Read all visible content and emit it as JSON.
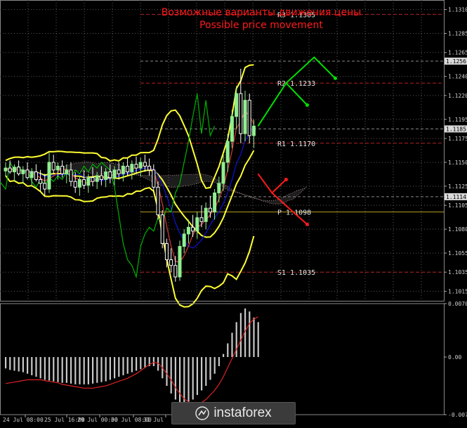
{
  "chart_data": {
    "type": "candlestick",
    "title": "Возможные варианты движения цены",
    "subtitle": "Possible price movement",
    "y_ticks": [
      "1.1310",
      "1.1285",
      "1.1265",
      "1.1240",
      "1.1220",
      "1.1195",
      "1.1175",
      "1.1150",
      "1.1125",
      "1.1105",
      "1.1080",
      "1.1055",
      "1.1035",
      "1.1015"
    ],
    "y_range": [
      1.1005,
      1.132
    ],
    "price_labels": [
      {
        "text": "1.1256",
        "value": 1.1256
      },
      {
        "text": "1.1185",
        "value": 1.1185
      },
      {
        "text": "1.1114",
        "value": 1.1114
      }
    ],
    "x_ticks": [
      "24 Jul 08:00",
      "25 Jul 16:00",
      "29 Jul 00:00",
      "30 Jul 08:00",
      "31 Jul"
    ],
    "levels": [
      {
        "name": "R3",
        "text": "R3 1.1305",
        "value": 1.1305
      },
      {
        "name": "R2",
        "text": "R2 1.1233",
        "value": 1.1233
      },
      {
        "name": "R1",
        "text": "R1 1.1170",
        "value": 1.117
      },
      {
        "name": "P",
        "text": "P 1.1098",
        "value": 1.1098
      },
      {
        "name": "S1",
        "text": "S1 1.1035",
        "value": 1.1035
      }
    ],
    "candles": [
      [
        1.1141,
        1.115,
        1.1135,
        1.1144
      ],
      [
        1.1144,
        1.1152,
        1.1138,
        1.114
      ],
      [
        1.114,
        1.1148,
        1.113,
        1.1145
      ],
      [
        1.1145,
        1.1152,
        1.1136,
        1.1138
      ],
      [
        1.1138,
        1.1146,
        1.1128,
        1.1142
      ],
      [
        1.1142,
        1.115,
        1.1132,
        1.1134
      ],
      [
        1.1134,
        1.1144,
        1.1125,
        1.114
      ],
      [
        1.114,
        1.1148,
        1.113,
        1.1132
      ],
      [
        1.1132,
        1.1142,
        1.112,
        1.1128
      ],
      [
        1.1128,
        1.1138,
        1.1115,
        1.1122
      ],
      [
        1.1122,
        1.116,
        1.1118,
        1.115
      ],
      [
        1.115,
        1.1158,
        1.1138,
        1.1142
      ],
      [
        1.1142,
        1.115,
        1.1132,
        1.1146
      ],
      [
        1.1146,
        1.1152,
        1.1134,
        1.1138
      ],
      [
        1.1138,
        1.1148,
        1.1128,
        1.1142
      ],
      [
        1.1142,
        1.115,
        1.1125,
        1.113
      ],
      [
        1.113,
        1.114,
        1.1118,
        1.1124
      ],
      [
        1.1124,
        1.1136,
        1.1115,
        1.1132
      ],
      [
        1.1132,
        1.1142,
        1.1122,
        1.1126
      ],
      [
        1.1126,
        1.1138,
        1.1118,
        1.1134
      ],
      [
        1.1134,
        1.1145,
        1.1125,
        1.113
      ],
      [
        1.113,
        1.114,
        1.1122,
        1.1136
      ],
      [
        1.1136,
        1.1146,
        1.1126,
        1.1132
      ],
      [
        1.1132,
        1.1144,
        1.1124,
        1.114
      ],
      [
        1.114,
        1.1148,
        1.1128,
        1.1134
      ],
      [
        1.1134,
        1.1146,
        1.1126,
        1.1142
      ],
      [
        1.1142,
        1.115,
        1.1132,
        1.1138
      ],
      [
        1.1138,
        1.115,
        1.113,
        1.1146
      ],
      [
        1.1146,
        1.1154,
        1.1136,
        1.114
      ],
      [
        1.114,
        1.1152,
        1.1132,
        1.1148
      ],
      [
        1.1148,
        1.1156,
        1.1138,
        1.1144
      ],
      [
        1.1144,
        1.1155,
        1.1135,
        1.115
      ],
      [
        1.115,
        1.1158,
        1.114,
        1.1146
      ],
      [
        1.1146,
        1.1154,
        1.1136,
        1.1142
      ],
      [
        1.1142,
        1.1148,
        1.112,
        1.1124
      ],
      [
        1.1124,
        1.113,
        1.109,
        1.1095
      ],
      [
        1.1095,
        1.11,
        1.106,
        1.1065
      ],
      [
        1.1065,
        1.107,
        1.104,
        1.1048
      ],
      [
        1.1048,
        1.106,
        1.1035,
        1.1042
      ],
      [
        1.1042,
        1.1052,
        1.1025,
        1.103
      ],
      [
        1.103,
        1.1068,
        1.1026,
        1.1062
      ],
      [
        1.1062,
        1.108,
        1.1055,
        1.1075
      ],
      [
        1.1075,
        1.109,
        1.1065,
        1.1082
      ],
      [
        1.1082,
        1.1095,
        1.1072,
        1.1078
      ],
      [
        1.1078,
        1.1098,
        1.107,
        1.1092
      ],
      [
        1.1092,
        1.1105,
        1.1082,
        1.1088
      ],
      [
        1.1088,
        1.1108,
        1.108,
        1.1102
      ],
      [
        1.1102,
        1.1115,
        1.1092,
        1.1098
      ],
      [
        1.1098,
        1.1122,
        1.109,
        1.1118
      ],
      [
        1.1118,
        1.1135,
        1.1108,
        1.1128
      ],
      [
        1.1128,
        1.1158,
        1.112,
        1.115
      ],
      [
        1.115,
        1.118,
        1.114,
        1.1172
      ],
      [
        1.1172,
        1.1205,
        1.1165,
        1.1198
      ],
      [
        1.1198,
        1.123,
        1.1185,
        1.1222
      ],
      [
        1.1222,
        1.1248,
        1.117,
        1.118
      ],
      [
        1.118,
        1.1225,
        1.1172,
        1.1215
      ],
      [
        1.1215,
        1.1222,
        1.117,
        1.1178
      ],
      [
        1.1178,
        1.1195,
        1.1165,
        1.1188
      ]
    ],
    "forecast_paths": [
      {
        "color": "#00e000",
        "points": [
          [
            0,
            1.1188
          ],
          [
            4,
            1.1233
          ],
          [
            7,
            1.121
          ]
        ]
      },
      {
        "color": "#00e000",
        "points": [
          [
            4,
            1.1233
          ],
          [
            8,
            1.126
          ],
          [
            11,
            1.1238
          ]
        ]
      },
      {
        "color": "#ff1a1a",
        "points": [
          [
            0,
            1.1138
          ],
          [
            2,
            1.1118
          ],
          [
            4,
            1.1132
          ]
        ]
      },
      {
        "color": "#ff1a1a",
        "points": [
          [
            2,
            1.1118
          ],
          [
            5,
            1.1098
          ],
          [
            7,
            1.1085
          ]
        ]
      }
    ],
    "macd_ticks": [
      "0.00704",
      "0.00",
      "-0.00759"
    ],
    "macd_range": [
      -0.00759,
      0.00704
    ],
    "macd_histogram": [
      -0.0015,
      -0.0017,
      -0.0018,
      -0.0019,
      -0.002,
      -0.0022,
      -0.0024,
      -0.0026,
      -0.0028,
      -0.003,
      -0.0031,
      -0.0032,
      -0.0033,
      -0.0034,
      -0.0034,
      -0.0035,
      -0.0036,
      -0.0036,
      -0.0036,
      -0.0036,
      -0.0035,
      -0.0034,
      -0.0033,
      -0.0032,
      -0.003,
      -0.0028,
      -0.0026,
      -0.0024,
      -0.0022,
      -0.002,
      -0.0018,
      -0.0016,
      -0.0014,
      -0.0012,
      -0.0012,
      -0.0018,
      -0.0028,
      -0.0038,
      -0.0048,
      -0.0056,
      -0.0062,
      -0.0062,
      -0.006,
      -0.0056,
      -0.005,
      -0.0044,
      -0.0038,
      -0.003,
      -0.0022,
      -0.0012,
      0.0004,
      0.0018,
      0.0032,
      0.0046,
      0.0058,
      0.0064,
      0.006,
      0.0052,
      0.0046
    ],
    "macd_signal": [
      -0.0035,
      -0.0034,
      -0.0033,
      -0.0032,
      -0.0031,
      -0.003,
      -0.003,
      -0.003,
      -0.003,
      -0.0031,
      -0.0032,
      -0.0033,
      -0.0034,
      -0.0036,
      -0.0037,
      -0.0038,
      -0.0039,
      -0.004,
      -0.0041,
      -0.0041,
      -0.0041,
      -0.004,
      -0.0039,
      -0.0038,
      -0.0036,
      -0.0034,
      -0.0032,
      -0.003,
      -0.0028,
      -0.0025,
      -0.0022,
      -0.0018,
      -0.0014,
      -0.001,
      -0.0007,
      -0.0008,
      -0.0014,
      -0.0022,
      -0.003,
      -0.004,
      -0.0048,
      -0.0055,
      -0.0059,
      -0.0062,
      -0.0062,
      -0.006,
      -0.0056,
      -0.005,
      -0.0044,
      -0.0036,
      -0.0026,
      -0.0014,
      -0.0002,
      0.001,
      0.0022,
      0.0034,
      0.0044,
      0.005,
      0.0053
    ]
  },
  "branding": {
    "logo_text": "instaforex"
  },
  "colors": {
    "bull": "#90ee90",
    "bear": "#ffffff",
    "bollinger": "#ffff33",
    "ichimoku_span": "#cc3333",
    "kijun": "#1010c8",
    "chikou": "#00b300",
    "grid": "#5a5a5a"
  }
}
